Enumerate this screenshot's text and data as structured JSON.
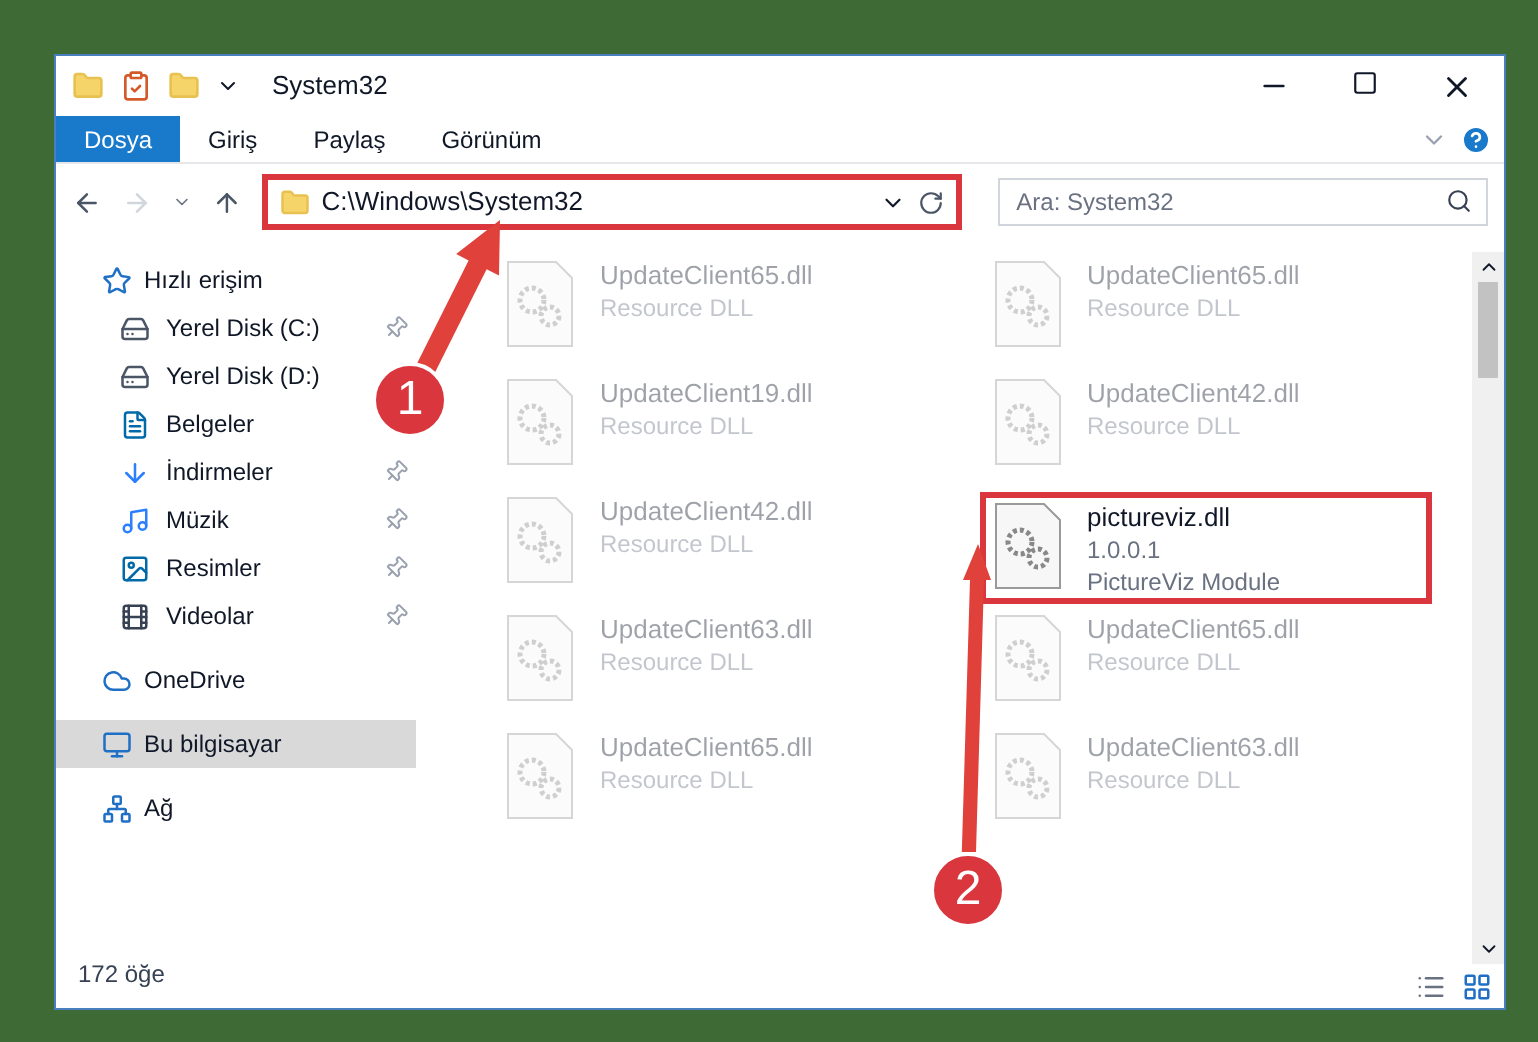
{
  "window": {
    "title": "System32"
  },
  "ribbon_tabs": [
    {
      "label": "Dosya",
      "selected": true
    },
    {
      "label": "Giriş",
      "selected": false
    },
    {
      "label": "Paylaş",
      "selected": false
    },
    {
      "label": "Görünüm",
      "selected": false
    }
  ],
  "address": {
    "path": "C:\\Windows\\System32",
    "highlighted": true
  },
  "search": {
    "placeholder": "Ara: System32"
  },
  "sidebar": {
    "items": [
      {
        "label": "Hızlı erişim",
        "selected": false,
        "children": [
          {
            "label": "Yerel Disk (C:)",
            "pinned": true
          },
          {
            "label": "Yerel Disk (D:)",
            "pinned": false
          },
          {
            "label": "Belgeler",
            "pinned": false
          },
          {
            "label": "İndirmeler",
            "pinned": true
          },
          {
            "label": "Müzik",
            "pinned": true
          },
          {
            "label": "Resimler",
            "pinned": true
          },
          {
            "label": "Videolar",
            "pinned": true
          }
        ]
      },
      {
        "label": "OneDrive",
        "selected": false
      },
      {
        "label": "Bu bilgisayar",
        "selected": true
      },
      {
        "label": "Ağ",
        "selected": false
      }
    ]
  },
  "files": [
    {
      "name": "UpdateClient65.dll",
      "description": "Resource DLL",
      "highlighted": false
    },
    {
      "name": "UpdateClient65.dll",
      "description": "Resource DLL",
      "highlighted": false
    },
    {
      "name": "UpdateClient19.dll",
      "description": "Resource DLL",
      "highlighted": false
    },
    {
      "name": "UpdateClient42.dll",
      "description": "Resource DLL",
      "highlighted": false
    },
    {
      "name": "UpdateClient42.dll",
      "description": "Resource DLL",
      "highlighted": false
    },
    {
      "name": "pictureviz.dll",
      "version": "1.0.0.1",
      "description": "PictureViz Module",
      "highlighted": true
    },
    {
      "name": "UpdateClient63.dll",
      "description": "Resource DLL",
      "highlighted": false
    },
    {
      "name": "UpdateClient65.dll",
      "description": "Resource DLL",
      "highlighted": false
    },
    {
      "name": "UpdateClient65.dll",
      "description": "Resource DLL",
      "highlighted": false
    },
    {
      "name": "UpdateClient63.dll",
      "description": "Resource DLL",
      "highlighted": false
    }
  ],
  "status_bar": {
    "count": "172 öğe"
  },
  "annotations": [
    {
      "number": "1"
    },
    {
      "number": "2"
    }
  ]
}
